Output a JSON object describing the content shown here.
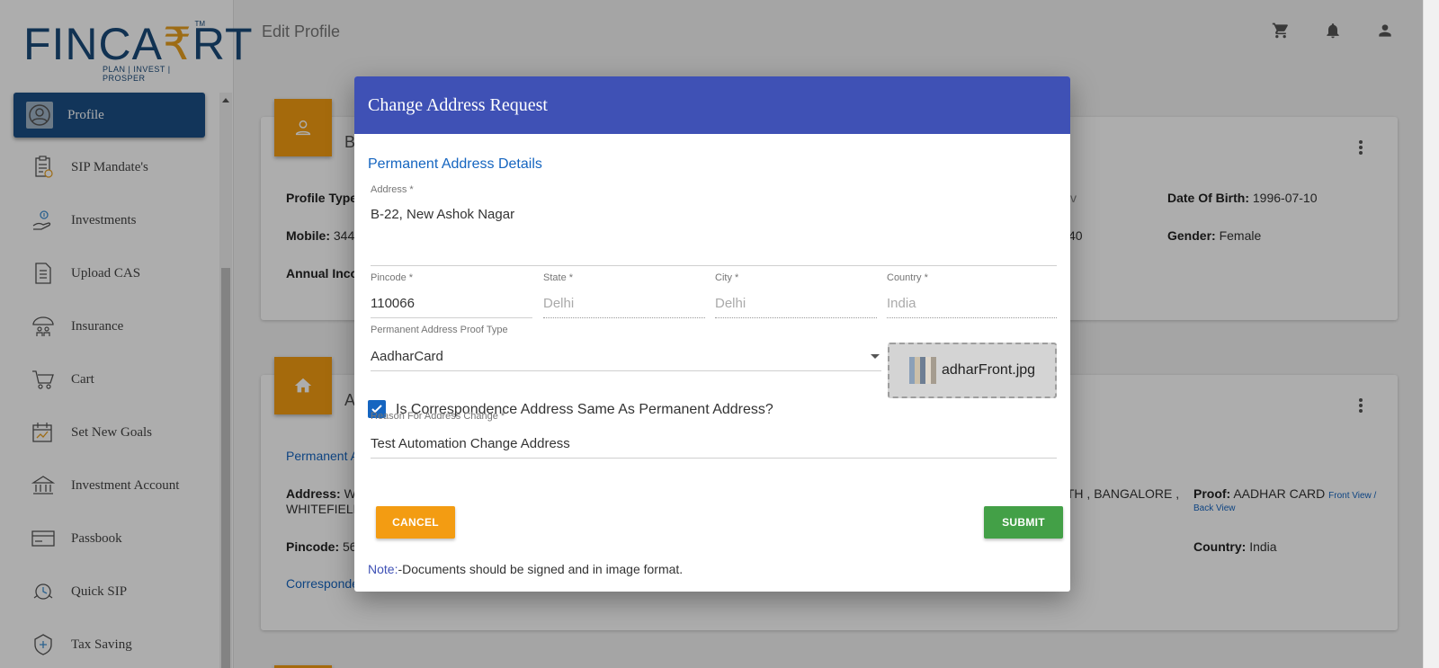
{
  "brand": {
    "name_a": "FINCA",
    "name_b": "RT",
    "tm": "TM",
    "tagline": "PLAN | INVEST | PROSPER"
  },
  "sidebar": {
    "items": [
      {
        "label": "Profile",
        "icon": "user-circle-icon"
      },
      {
        "label": "SIP Mandate's",
        "icon": "clipboard-icon"
      },
      {
        "label": "Investments",
        "icon": "hand-coins-icon"
      },
      {
        "label": "Upload CAS",
        "icon": "document-icon"
      },
      {
        "label": "Insurance",
        "icon": "umbrella-family-icon"
      },
      {
        "label": "Cart",
        "icon": "cart-icon"
      },
      {
        "label": "Set New Goals",
        "icon": "calendar-goals-icon"
      },
      {
        "label": "Investment Account",
        "icon": "bank-icon"
      },
      {
        "label": "Passbook",
        "icon": "card-icon"
      },
      {
        "label": "Quick SIP",
        "icon": "quick-sip-icon"
      },
      {
        "label": "Tax Saving",
        "icon": "tax-icon"
      }
    ]
  },
  "header": {
    "title": "Edit Profile"
  },
  "background": {
    "card1": {
      "heading_fragment": "B",
      "profile_type_label": "Profile Type",
      "mobile_label": "Mobile:",
      "mobile_fragment": "344",
      "annual_label": "Annual Inco",
      "dob_label": "Date Of Birth:",
      "dob_value": "1996-07-10",
      "gender_label": "Gender:",
      "gender_value": "Female",
      "frag_v": "v",
      "frag_40": "40"
    },
    "card2": {
      "heading_fragment": "A",
      "permanent_fragment": "Permanent A",
      "address_label": "Address:",
      "address_fragment": "W",
      "whitefield_fragment": "WHITEFIELD",
      "address_right_fragment": "RTH , BANGALORE ,",
      "proof_label": "Proof:",
      "proof_value": "AADHAR CARD",
      "front_view": "Front View /",
      "back_view": "Back View",
      "pincode_label": "Pincode:",
      "pincode_fragment": "56",
      "country_label": "Country:",
      "country_value": "India",
      "correspondence_fragment": "Corresponde"
    }
  },
  "dialog": {
    "title": "Change Address Request",
    "section_title": "Permanent Address Details",
    "address": {
      "label": "Address *",
      "value": "B-22, New Ashok Nagar"
    },
    "pincode": {
      "label": "Pincode *",
      "value": "110066"
    },
    "state": {
      "label": "State *",
      "value": "Delhi"
    },
    "city": {
      "label": "City *",
      "value": "Delhi"
    },
    "country": {
      "label": "Country *",
      "value": "India"
    },
    "proof_type": {
      "label": "Permanent Address Proof Type",
      "value": "AadharCard"
    },
    "file_name": "adharFront.jpg",
    "same_address": {
      "label": "Is Correspondence Address Same As Permanent Address?",
      "checked": true
    },
    "reason": {
      "label": "Reason For Address Change *",
      "value": "Test Automation Change Address"
    },
    "cancel_label": "CANCEL",
    "submit_label": "SUBMIT",
    "note_prefix": "Note:",
    "note_text": "-Documents should be signed and in image format."
  },
  "colors": {
    "sidebar_active": "#1b4f85",
    "dialog_header": "#3f51b5",
    "cancel_button": "#f39c12",
    "submit_button": "#43a047",
    "badge": "#f39c12"
  }
}
